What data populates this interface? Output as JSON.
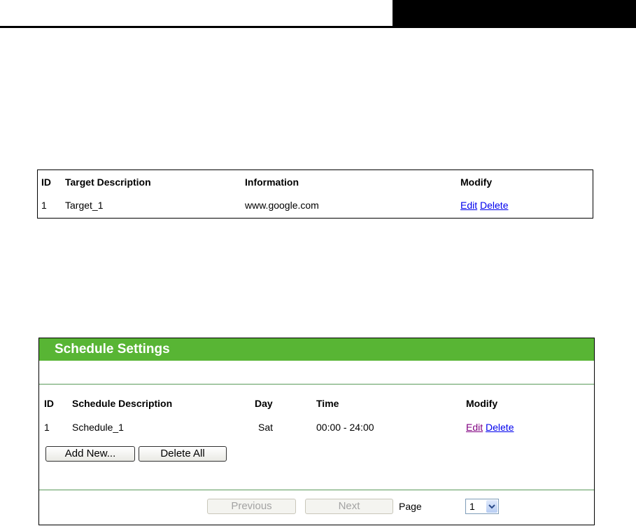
{
  "target_table": {
    "headers": {
      "id": "ID",
      "description": "Target Description",
      "information": "Information",
      "modify": "Modify"
    },
    "rows": [
      {
        "id": "1",
        "description": "Target_1",
        "information": "www.google.com",
        "edit": "Edit",
        "delete": "Delete"
      }
    ]
  },
  "schedule": {
    "title": "Schedule Settings",
    "headers": {
      "id": "ID",
      "description": "Schedule Description",
      "day": "Day",
      "time": "Time",
      "modify": "Modify"
    },
    "rows": [
      {
        "id": "1",
        "description": "Schedule_1",
        "day": "Sat",
        "time": "00:00 - 24:00",
        "edit": "Edit",
        "delete": "Delete"
      }
    ],
    "buttons": {
      "add_new": "Add New...",
      "delete_all": "Delete All",
      "previous": "Previous",
      "next": "Next"
    },
    "pager": {
      "label": "Page",
      "current": "1"
    }
  },
  "colors": {
    "header_green": "#58b534",
    "link_blue": "#0000ee",
    "link_visited": "#800080"
  }
}
